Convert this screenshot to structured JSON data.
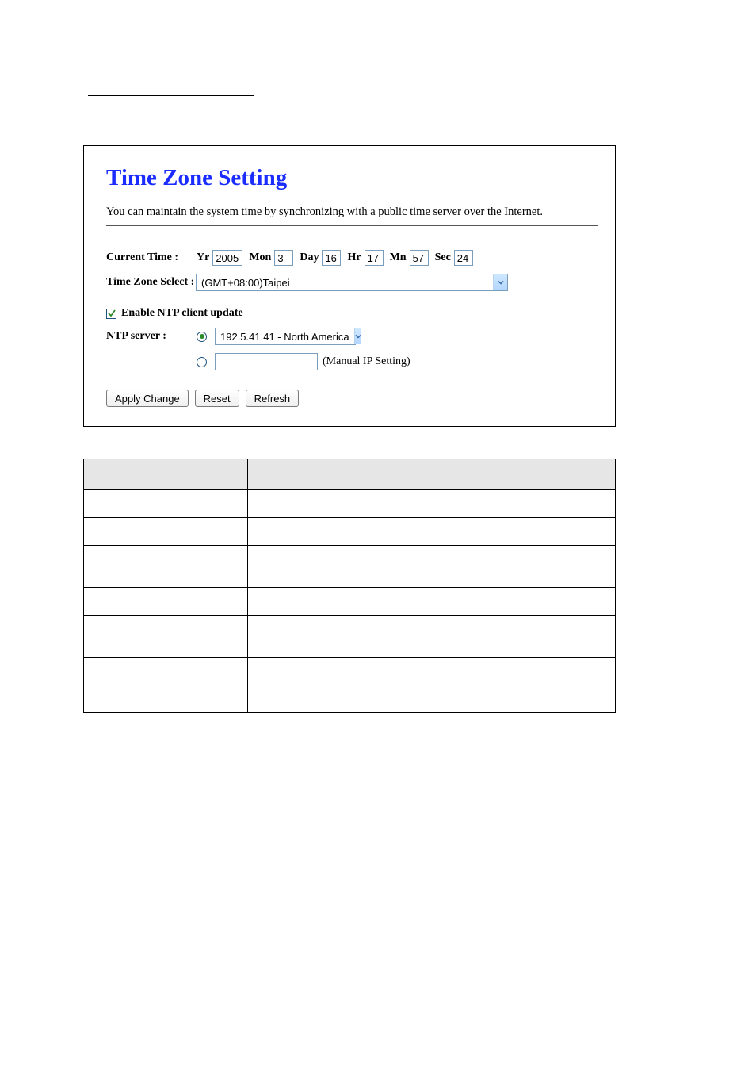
{
  "panel": {
    "title": "Time Zone Setting",
    "description": "You can maintain the system time by synchronizing with a public time server over the Internet.",
    "currentTime": {
      "label": "Current Time :",
      "parts": {
        "yr_label": "Yr",
        "yr": "2005",
        "mon_label": "Mon",
        "mon": "3",
        "day_label": "Day",
        "day": "16",
        "hr_label": "Hr",
        "hr": "17",
        "mn_label": "Mn",
        "mn": "57",
        "sec_label": "Sec",
        "sec": "24"
      }
    },
    "timeZone": {
      "label": "Time Zone Select :",
      "value": "(GMT+08:00)Taipei"
    },
    "enableNtp": {
      "checked": true,
      "label": "Enable NTP client update"
    },
    "ntp": {
      "label": "NTP server :",
      "server_value": "192.5.41.41 - North America",
      "manual_label": "(Manual IP Setting)"
    },
    "buttons": {
      "apply": "Apply Change",
      "reset": "Reset",
      "refresh": "Refresh"
    }
  },
  "table": {
    "headers": [
      "",
      ""
    ],
    "rows": [
      [
        "",
        ""
      ],
      [
        "",
        ""
      ],
      [
        "",
        ""
      ],
      [
        "",
        ""
      ],
      [
        "",
        ""
      ],
      [
        "",
        ""
      ],
      [
        "",
        ""
      ]
    ]
  }
}
